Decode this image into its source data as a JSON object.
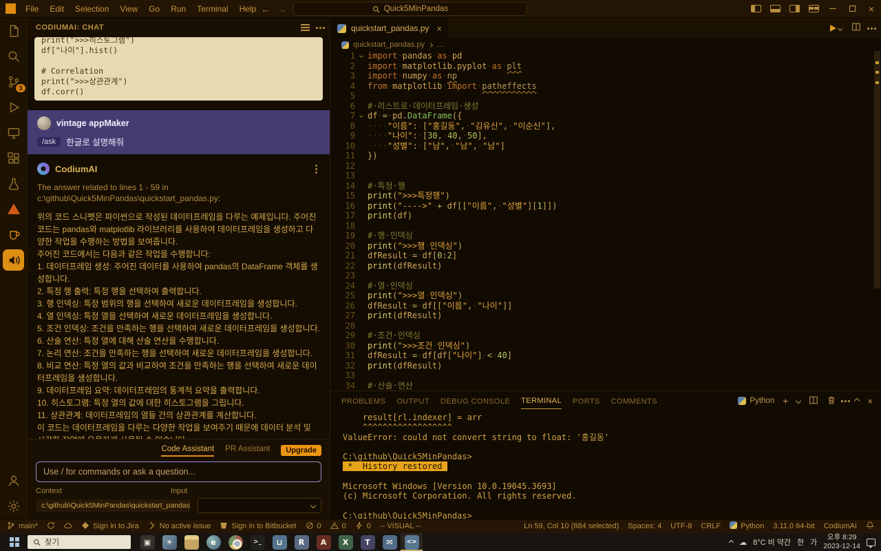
{
  "titlebar": {
    "menus": [
      "File",
      "Edit",
      "Selection",
      "View",
      "Go",
      "Run",
      "Terminal",
      "Help"
    ],
    "search_value": "Quick5MinPandas"
  },
  "activitybar": {
    "items": [
      {
        "name": "explorer"
      },
      {
        "name": "search"
      },
      {
        "name": "source-control",
        "icon": "scm",
        "badge": "3"
      },
      {
        "name": "run-debug",
        "icon": "debug"
      },
      {
        "name": "remote-explorer",
        "icon": "remote"
      },
      {
        "name": "extensions",
        "icon": "ext"
      },
      {
        "name": "testing",
        "icon": "test"
      },
      {
        "name": "warning-extension",
        "icon": "warn",
        "cls": "ab-warning"
      },
      {
        "name": "cup-extension",
        "icon": "cup",
        "cls": "ab-cup"
      },
      {
        "name": "codiumai",
        "icon": "codium",
        "active": true
      }
    ],
    "bottom": [
      {
        "name": "account",
        "icon": "account"
      },
      {
        "name": "settings",
        "icon": "gear"
      }
    ]
  },
  "chat": {
    "title": "CODIUMAI: CHAT",
    "prev_code": [
      "print(\">>>히스토그램\")",
      "df[\"나이\"].hist()",
      "",
      "# Correlation",
      "print(\">>>상관관계\")",
      "df.corr()"
    ],
    "user": {
      "name": "vintage appMaker",
      "command": "/ask",
      "message": "한글로 설명해줘"
    },
    "assistant": {
      "name": "CodiumAI",
      "intro_line1": "The answer related to lines 1 - 59 in",
      "intro_line2": "c:\\github\\Quick5MinPandas\\quickstart_pandas.py:",
      "paragraphs": [
        "위의 코드 스니펫은 파이썬으로 작성된 데이터프레임을 다루는 예제입니다. 주어진 코드는 pandas와 matplotlib 라이브러리를 사용하여 데이터프레임을 생성하고 다양한 작업을 수행하는 방법을 보여줍니다.",
        "주어진 코드에서는 다음과 같은 작업을 수행합니다:",
        "1. 데이터프레임 생성: 주어진 데이터를 사용하여 pandas의 DataFrame 객체를 생성합니다.",
        "2. 특정 행 출력: 특정 행을 선택하여 출력합니다.",
        "3. 행 인덱싱: 특정 범위의 행을 선택하여 새로운 데이터프레임을 생성합니다.",
        "4. 열 인덱싱: 특정 열을 선택하여 새로운 데이터프레임을 생성합니다.",
        "5. 조건 인덱싱: 조건을 만족하는 행을 선택하여 새로운 데이터프레임을 생성합니다.",
        "6. 산술 연산: 특정 열에 대해 산술 연산을 수행합니다.",
        "7. 논리 연산: 조건을 만족하는 행을 선택하여 새로운 데이터프레임을 생성합니다.",
        "8. 비교 연산: 특정 열의 값과 비교하여 조건을 만족하는 행을 선택하여 새로운 데이터프레임을 생성합니다.",
        "9. 데이터프레임 요약: 데이터프레임의 통계적 요약을 출력합니다.",
        "10. 히스토그램: 특정 열의 값에 대한 히스토그램을 그립니다.",
        "11. 상관관계: 데이터프레임의 열들 간의 상관관계를 계산합니다.",
        "이 코드는 데이터프레임을 다루는 다양한 작업을 보여주기 때문에 데이터 분석 및 시각화 작업에 유용하게 사용될 수 있습니다."
      ]
    },
    "footer_tabs": [
      {
        "label": "Code Assistant",
        "active": true
      },
      {
        "label": "PR Assistant",
        "active": false
      }
    ],
    "upgrade_label": "Upgrade",
    "input_placeholder": "Use / for commands or ask a question...",
    "context_label": "Context",
    "input_label": "Input",
    "context_value": "c:\\github\\Quick5MinPandas\\quickstart_pandas.py"
  },
  "editor": {
    "tab_label": "quickstart_pandas.py",
    "breadcrumb_file": "quickstart_pandas.py",
    "breadcrumb_more": "…",
    "lines": [
      {
        "f": 1,
        "t": [
          [
            "kw",
            "import"
          ],
          [
            "ws",
            "·"
          ],
          [
            "id",
            "pandas"
          ],
          [
            "ws",
            "·"
          ],
          [
            "kw",
            "as"
          ],
          [
            "ws",
            "·"
          ],
          [
            "id",
            "pd"
          ]
        ]
      },
      {
        "t": [
          [
            "kw",
            "import"
          ],
          [
            "ws",
            "·"
          ],
          [
            "id",
            "matplotlib.pyplot"
          ],
          [
            "ws",
            "·"
          ],
          [
            "kw",
            "as"
          ],
          [
            "ws",
            "·"
          ],
          [
            "un",
            "plt"
          ]
        ]
      },
      {
        "t": [
          [
            "kw",
            "import"
          ],
          [
            "ws",
            "·"
          ],
          [
            "id",
            "numpy"
          ],
          [
            "ws",
            "·"
          ],
          [
            "kw",
            "as"
          ],
          [
            "ws",
            "·"
          ],
          [
            "un",
            "np"
          ]
        ]
      },
      {
        "t": [
          [
            "kw",
            "from"
          ],
          [
            "ws",
            "·"
          ],
          [
            "id",
            "matplotlib"
          ],
          [
            "ws",
            "·"
          ],
          [
            "kw",
            "import"
          ],
          [
            "ws",
            "·"
          ],
          [
            "un",
            "patheffects"
          ]
        ]
      },
      {
        "t": []
      },
      {
        "t": [
          [
            "cmt",
            "#·리스트로·데이터프레임·생성"
          ]
        ]
      },
      {
        "f": 1,
        "t": [
          [
            "id",
            "df"
          ],
          [
            "ws",
            "·"
          ],
          [
            "op",
            "="
          ],
          [
            "ws",
            "·"
          ],
          [
            "id",
            "pd"
          ],
          [
            "pun",
            "."
          ],
          [
            "cls",
            "DataFrame"
          ],
          [
            "pun",
            "({"
          ]
        ]
      },
      {
        "t": [
          [
            "ws",
            "····"
          ],
          [
            "str",
            "\"이름\""
          ],
          [
            "pun",
            ":"
          ],
          [
            "ws",
            "·"
          ],
          [
            "pun",
            "["
          ],
          [
            "str",
            "\"홍길동\""
          ],
          [
            "pun",
            ","
          ],
          [
            "ws",
            "·"
          ],
          [
            "str",
            "\"김유신\""
          ],
          [
            "pun",
            ","
          ],
          [
            "ws",
            "·"
          ],
          [
            "str",
            "\"이순신\""
          ],
          [
            "pun",
            "],"
          ]
        ]
      },
      {
        "t": [
          [
            "ws",
            "····"
          ],
          [
            "str",
            "\"나이\""
          ],
          [
            "pun",
            ":"
          ],
          [
            "ws",
            "·"
          ],
          [
            "pun",
            "["
          ],
          [
            "num",
            "30"
          ],
          [
            "pun",
            ","
          ],
          [
            "ws",
            "·"
          ],
          [
            "num",
            "40"
          ],
          [
            "pun",
            ","
          ],
          [
            "ws",
            "·"
          ],
          [
            "num",
            "50"
          ],
          [
            "pun",
            "],"
          ]
        ]
      },
      {
        "t": [
          [
            "ws",
            "····"
          ],
          [
            "str",
            "\"성별\""
          ],
          [
            "pun",
            ":"
          ],
          [
            "ws",
            "·"
          ],
          [
            "pun",
            "["
          ],
          [
            "str",
            "\"남\""
          ],
          [
            "pun",
            ","
          ],
          [
            "ws",
            "·"
          ],
          [
            "str",
            "\"남\""
          ],
          [
            "pun",
            ","
          ],
          [
            "ws",
            "·"
          ],
          [
            "str",
            "\"남\""
          ],
          [
            "pun",
            "]"
          ]
        ]
      },
      {
        "t": [
          [
            "pun",
            "})"
          ]
        ]
      },
      {
        "t": []
      },
      {
        "t": []
      },
      {
        "t": [
          [
            "cmt",
            "#·특정·행"
          ]
        ]
      },
      {
        "t": [
          [
            "fn",
            "print"
          ],
          [
            "pun",
            "("
          ],
          [
            "str",
            "\">>>특정행\""
          ],
          [
            "pun",
            ")"
          ]
        ]
      },
      {
        "t": [
          [
            "fn",
            "print"
          ],
          [
            "pun",
            "("
          ],
          [
            "str",
            "\"---->\""
          ],
          [
            "ws",
            "·"
          ],
          [
            "op",
            "+"
          ],
          [
            "ws",
            "·"
          ],
          [
            "id",
            "df"
          ],
          [
            "pun",
            "[["
          ],
          [
            "str",
            "\"이름\""
          ],
          [
            "pun",
            ","
          ],
          [
            "ws",
            "·"
          ],
          [
            "str",
            "\"성별\""
          ],
          [
            "pun",
            "]["
          ],
          [
            "num",
            "1"
          ],
          [
            "pun",
            "]])"
          ]
        ]
      },
      {
        "t": [
          [
            "fn",
            "print"
          ],
          [
            "pun",
            "("
          ],
          [
            "id",
            "df"
          ],
          [
            "pun",
            ")"
          ]
        ]
      },
      {
        "t": []
      },
      {
        "t": [
          [
            "cmt",
            "#·행·인덱싱"
          ]
        ]
      },
      {
        "t": [
          [
            "fn",
            "print"
          ],
          [
            "pun",
            "("
          ],
          [
            "str",
            "\">>>행"
          ],
          [
            "ws",
            "·"
          ],
          [
            "str",
            "인덱싱\""
          ],
          [
            "pun",
            ")"
          ]
        ]
      },
      {
        "t": [
          [
            "id",
            "dfResult"
          ],
          [
            "ws",
            "·"
          ],
          [
            "op",
            "="
          ],
          [
            "ws",
            "·"
          ],
          [
            "id",
            "df"
          ],
          [
            "pun",
            "["
          ],
          [
            "num",
            "0"
          ],
          [
            "op",
            ":"
          ],
          [
            "num",
            "2"
          ],
          [
            "pun",
            "]"
          ]
        ]
      },
      {
        "t": [
          [
            "fn",
            "print"
          ],
          [
            "pun",
            "("
          ],
          [
            "id",
            "dfResult"
          ],
          [
            "pun",
            ")"
          ]
        ]
      },
      {
        "t": []
      },
      {
        "t": [
          [
            "cmt",
            "#·열·인덱싱"
          ]
        ]
      },
      {
        "t": [
          [
            "fn",
            "print"
          ],
          [
            "pun",
            "("
          ],
          [
            "str",
            "\">>>열"
          ],
          [
            "ws",
            "·"
          ],
          [
            "str",
            "인덱싱\""
          ],
          [
            "pun",
            ")"
          ]
        ]
      },
      {
        "t": [
          [
            "id",
            "dfResult"
          ],
          [
            "ws",
            "·"
          ],
          [
            "op",
            "="
          ],
          [
            "ws",
            "·"
          ],
          [
            "id",
            "df"
          ],
          [
            "pun",
            "[["
          ],
          [
            "str",
            "\"이름\""
          ],
          [
            "pun",
            ","
          ],
          [
            "ws",
            "·"
          ],
          [
            "str",
            "\"나이\""
          ],
          [
            "pun",
            "]]"
          ]
        ]
      },
      {
        "t": [
          [
            "fn",
            "print"
          ],
          [
            "pun",
            "("
          ],
          [
            "id",
            "dfResult"
          ],
          [
            "pun",
            ")"
          ]
        ]
      },
      {
        "t": []
      },
      {
        "t": [
          [
            "cmt",
            "#·조건·인덱싱"
          ]
        ]
      },
      {
        "t": [
          [
            "fn",
            "print"
          ],
          [
            "pun",
            "("
          ],
          [
            "str",
            "\">>>조건"
          ],
          [
            "ws",
            "·"
          ],
          [
            "str",
            "인덱싱\""
          ],
          [
            "pun",
            ")"
          ]
        ]
      },
      {
        "t": [
          [
            "id",
            "dfResult"
          ],
          [
            "ws",
            "·"
          ],
          [
            "op",
            "="
          ],
          [
            "ws",
            "·"
          ],
          [
            "id",
            "df"
          ],
          [
            "pun",
            "["
          ],
          [
            "id",
            "df"
          ],
          [
            "pun",
            "["
          ],
          [
            "str",
            "\"나이\""
          ],
          [
            "pun",
            "]"
          ],
          [
            "ws",
            "·"
          ],
          [
            "op",
            "<"
          ],
          [
            "ws",
            "·"
          ],
          [
            "num",
            "40"
          ],
          [
            "pun",
            "]"
          ]
        ]
      },
      {
        "t": [
          [
            "fn",
            "print"
          ],
          [
            "pun",
            "("
          ],
          [
            "id",
            "dfResult"
          ],
          [
            "pun",
            ")"
          ]
        ]
      },
      {
        "t": []
      },
      {
        "t": [
          [
            "cmt",
            "#·산술·연산"
          ]
        ]
      }
    ]
  },
  "panel": {
    "tabs": [
      {
        "label": "PROBLEMS"
      },
      {
        "label": "OUTPUT"
      },
      {
        "label": "DEBUG CONSOLE"
      },
      {
        "label": "TERMINAL",
        "active": true
      },
      {
        "label": "PORTS"
      },
      {
        "label": "COMMENTS"
      }
    ],
    "shell_label": "Python",
    "terminal_lines": [
      {
        "text": "    result[rl.indexer] = arr"
      },
      {
        "text": "    ^^^^^^^^^^^^^^^^^^"
      },
      {
        "text": "ValueError: could not convert string to float: '홍길동'"
      },
      {
        "text": ""
      },
      {
        "text": "C:\\github\\Quick5MinPandas>"
      },
      {
        "text": " *  History restored ",
        "highlight": true
      },
      {
        "text": ""
      },
      {
        "text": "Microsoft Windows [Version 10.0.19045.3693]"
      },
      {
        "text": "(c) Microsoft Corporation. All rights reserved."
      },
      {
        "text": ""
      },
      {
        "text": "C:\\github\\Quick5MinPandas>"
      }
    ]
  },
  "statusbar": {
    "left": [
      {
        "name": "git-branch",
        "icon": "branch",
        "label": "main*"
      },
      {
        "name": "git-sync",
        "icon": "sync",
        "label": ""
      },
      {
        "name": "publish",
        "icon": "cloud",
        "label": ""
      },
      {
        "name": "jira-signin",
        "icon": "jira",
        "label": "Sign in to Jira"
      },
      {
        "name": "active-issue",
        "icon": "chevron",
        "label": "No active issue"
      },
      {
        "name": "bitbucket-signin",
        "icon": "bitbucket",
        "label": "Sign in to Bitbucket"
      },
      {
        "name": "problems-errors",
        "icon": "noerr",
        "label": "0"
      },
      {
        "name": "problems-warnings",
        "icon": "warn",
        "label": "0"
      },
      {
        "name": "feedback",
        "icon": "zap",
        "label": "0"
      },
      {
        "name": "vim-mode",
        "label": "-- VISUAL --"
      }
    ],
    "right": [
      {
        "name": "cursor-position",
        "label": "Ln 59, Col 10 (884 selected)"
      },
      {
        "name": "indentation",
        "label": "Spaces: 4"
      },
      {
        "name": "encoding",
        "label": "UTF-8"
      },
      {
        "name": "eol",
        "label": "CRLF"
      },
      {
        "name": "language-mode",
        "icon": "python",
        "label": "Python"
      },
      {
        "name": "python-interpreter",
        "label": "3.11.0 64-bit"
      },
      {
        "name": "codiumai-status",
        "label": "CodiumAI"
      },
      {
        "name": "notifications",
        "icon": "bell",
        "label": ""
      }
    ]
  },
  "taskbar": {
    "search_placeholder": "찾기",
    "apps": [
      {
        "name": "taskview",
        "glyph": "▣"
      },
      {
        "name": "widgets",
        "glyph": "☀"
      },
      {
        "name": "files",
        "glyph": ""
      },
      {
        "name": "edge",
        "glyph": "e"
      },
      {
        "name": "chrome",
        "glyph": ""
      },
      {
        "name": "terminal",
        "glyph": ">_"
      },
      {
        "name": "store",
        "glyph": "⊔"
      },
      {
        "name": "remote",
        "glyph": "R"
      },
      {
        "name": "acrobat",
        "glyph": "A"
      },
      {
        "name": "excel",
        "glyph": "X"
      },
      {
        "name": "teams",
        "glyph": "T"
      },
      {
        "name": "mail",
        "glyph": "✉"
      },
      {
        "name": "vscode",
        "glyph": "<>",
        "active": true
      }
    ],
    "tray": {
      "weather": "8°C 비 약간",
      "ime": "한",
      "ime2": "가",
      "time": "오후 8:29",
      "date": "2023-12-14"
    }
  }
}
